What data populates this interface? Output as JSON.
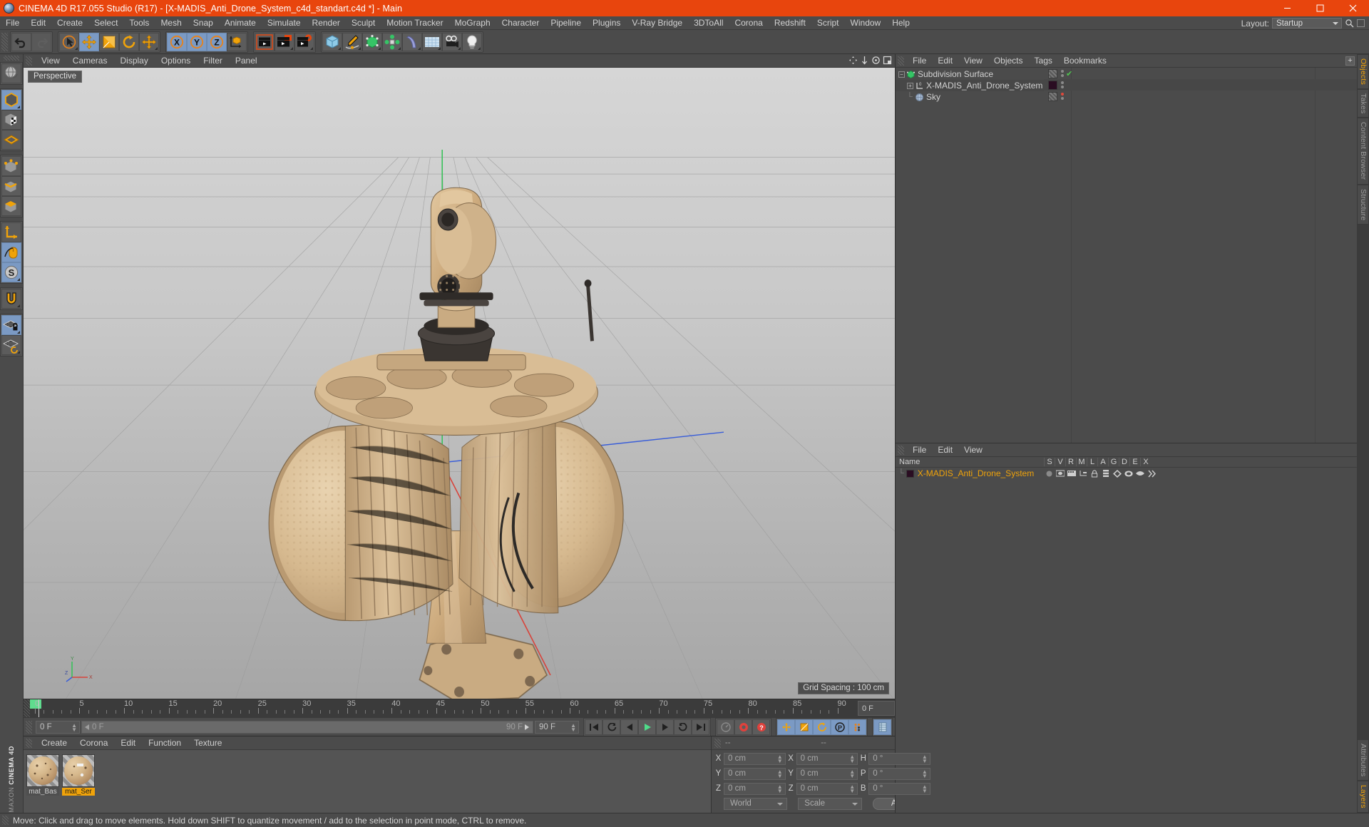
{
  "window": {
    "title": "CINEMA 4D R17.055 Studio (R17) - [X-MADIS_Anti_Drone_System_c4d_standart.c4d *] - Main",
    "app_icon": "c4d-logo-icon",
    "minimize": "minimize-icon",
    "maximize": "maximize-icon",
    "close": "close-icon",
    "titlebar_color": "#e8450d"
  },
  "menubar": {
    "items": [
      "File",
      "Edit",
      "Create",
      "Select",
      "Tools",
      "Mesh",
      "Snap",
      "Animate",
      "Simulate",
      "Render",
      "Sculpt",
      "Motion Tracker",
      "MoGraph",
      "Character",
      "Pipeline",
      "Plugins",
      "V-Ray Bridge",
      "3DToAll",
      "Corona",
      "Redshift",
      "Script",
      "Window",
      "Help"
    ],
    "layout_label": "Layout:",
    "layout_value": "Startup",
    "search_icon": "search-icon",
    "panel_icon": "panel-icon"
  },
  "toolbar": {
    "groups": [
      {
        "name": "history",
        "buttons": [
          {
            "name": "undo-button",
            "icon": "undo-icon",
            "active": false,
            "dim": false
          },
          {
            "name": "redo-button",
            "icon": "redo-icon",
            "active": false,
            "dim": true
          }
        ]
      },
      {
        "name": "selection-transform",
        "buttons": [
          {
            "name": "live-selection-button",
            "icon": "live-selection-icon",
            "active": false,
            "dim": false
          },
          {
            "name": "move-tool-button",
            "icon": "move-icon",
            "active": true,
            "dim": false
          },
          {
            "name": "scale-tool-button",
            "icon": "scale-icon",
            "active": false,
            "dim": false
          },
          {
            "name": "rotate-tool-button",
            "icon": "rotate-icon",
            "active": false,
            "dim": false
          },
          {
            "name": "move-alt-button",
            "icon": "move-icon",
            "active": false,
            "dim": false
          }
        ]
      },
      {
        "name": "axis-locks",
        "buttons": [
          {
            "name": "lock-x-button",
            "icon": "x-axis-icon",
            "active": true,
            "dim": false
          },
          {
            "name": "lock-y-button",
            "icon": "y-axis-icon",
            "active": true,
            "dim": false
          },
          {
            "name": "lock-z-button",
            "icon": "z-axis-icon",
            "active": true,
            "dim": false
          },
          {
            "name": "world-object-coordinates-button",
            "icon": "world-axis-icon",
            "active": false,
            "dim": false
          }
        ]
      },
      {
        "name": "render",
        "buttons": [
          {
            "name": "render-view-button",
            "icon": "render-view-icon",
            "active": false,
            "dim": false
          },
          {
            "name": "render-to-picture-viewer-button",
            "icon": "render-picture-viewer-icon",
            "active": false,
            "dim": false
          },
          {
            "name": "render-settings-button",
            "icon": "render-settings-icon",
            "active": false,
            "dim": false
          }
        ]
      },
      {
        "name": "primitives",
        "buttons": [
          {
            "name": "cube-primitive-button",
            "icon": "cube-icon",
            "active": false,
            "dim": false
          },
          {
            "name": "spline-pen-button",
            "icon": "pen-spline-icon",
            "active": false,
            "dim": false
          },
          {
            "name": "nurbs-button",
            "icon": "subdivision-surface-icon",
            "active": false,
            "dim": false
          },
          {
            "name": "array-button",
            "icon": "array-icon",
            "active": false,
            "dim": false
          },
          {
            "name": "bend-deformer-button",
            "icon": "bend-deformer-icon",
            "active": false,
            "dim": false
          },
          {
            "name": "floor-environment-button",
            "icon": "floor-icon",
            "active": false,
            "dim": false
          },
          {
            "name": "camera-button",
            "icon": "camera-icon",
            "active": false,
            "dim": false
          },
          {
            "name": "light-button",
            "icon": "light-bulb-icon",
            "active": false,
            "dim": false
          }
        ]
      }
    ]
  },
  "left_toolbar": {
    "groups": [
      [
        {
          "name": "undo-view-button",
          "icon": "globe-undo-icon",
          "active": false
        }
      ],
      [
        {
          "name": "make-editable-button",
          "icon": "make-editable-icon",
          "active": true
        },
        {
          "name": "model-mode-button",
          "icon": "model-mode-icon",
          "active": false
        },
        {
          "name": "texture-mode-button",
          "icon": "texture-axis-icon",
          "active": false
        }
      ],
      [
        {
          "name": "points-mode-button",
          "icon": "points-mode-icon",
          "active": false
        },
        {
          "name": "edges-mode-button",
          "icon": "edges-mode-icon",
          "active": false
        },
        {
          "name": "polygons-mode-button",
          "icon": "polygons-mode-icon",
          "active": false
        }
      ],
      [
        {
          "name": "enable-axis-modification-button",
          "icon": "axis-modification-icon",
          "active": false
        },
        {
          "name": "viewport-solo-button",
          "icon": "mouse-icon",
          "active": true
        },
        {
          "name": "soft-selection-button",
          "icon": "soft-selection-icon",
          "active": true
        }
      ],
      [
        {
          "name": "enable-snapping-button",
          "icon": "magnet-snap-icon",
          "active": false
        }
      ],
      [
        {
          "name": "lock-workplane-button",
          "icon": "workplane-lock-icon",
          "active": true
        },
        {
          "name": "workplane-rotate-button",
          "icon": "workplane-rotate-icon",
          "active": false
        }
      ]
    ],
    "brand_top": "MAXON",
    "brand_bottom": "CINEMA 4D"
  },
  "viewport": {
    "menu": [
      "View",
      "Cameras",
      "Display",
      "Options",
      "Filter",
      "Panel"
    ],
    "view_label": "Perspective",
    "grid_spacing": "Grid Spacing : 100 cm",
    "axis_labels": {
      "x": "X",
      "y": "Y",
      "z": "Z"
    },
    "corner_icons": [
      "pan-view-icon",
      "zoom-view-icon",
      "rotate-view-icon",
      "maximize-view-icon"
    ]
  },
  "timeline": {
    "ticks": [
      {
        "label": "0",
        "value": 0
      },
      {
        "label": "5",
        "value": 5
      },
      {
        "label": "10",
        "value": 10
      },
      {
        "label": "15",
        "value": 15
      },
      {
        "label": "20",
        "value": 20
      },
      {
        "label": "25",
        "value": 25
      },
      {
        "label": "30",
        "value": 30
      },
      {
        "label": "35",
        "value": 35
      },
      {
        "label": "40",
        "value": 40
      },
      {
        "label": "45",
        "value": 45
      },
      {
        "label": "50",
        "value": 50
      },
      {
        "label": "55",
        "value": 55
      },
      {
        "label": "60",
        "value": 60
      },
      {
        "label": "65",
        "value": 65
      },
      {
        "label": "70",
        "value": 70
      },
      {
        "label": "75",
        "value": 75
      },
      {
        "label": "80",
        "value": 80
      },
      {
        "label": "85",
        "value": 85
      },
      {
        "label": "90",
        "value": 90
      }
    ],
    "current_frame_box": "0 F",
    "range_start": "0 F",
    "range_end": "90 F",
    "max_frame": "90 F",
    "min_frame": "0 F"
  },
  "playback": {
    "buttons": [
      {
        "name": "go-to-start-button",
        "icon": "skip-start-icon",
        "active": false
      },
      {
        "name": "go-to-previous-key-button",
        "icon": "previous-key-icon",
        "active": false
      },
      {
        "name": "step-back-button",
        "icon": "step-back-icon",
        "active": false
      },
      {
        "name": "play-button",
        "icon": "play-icon",
        "active": false
      },
      {
        "name": "step-forward-button",
        "icon": "step-forward-icon",
        "active": false
      },
      {
        "name": "go-to-next-key-button",
        "icon": "next-key-icon",
        "active": false
      },
      {
        "name": "go-to-end-button",
        "icon": "skip-end-icon",
        "active": false
      }
    ],
    "record_buttons": [
      {
        "name": "autokeying-button",
        "icon": "autokey-icon",
        "active": false
      },
      {
        "name": "record-active-objects-button",
        "icon": "record-icon",
        "active": false
      },
      {
        "name": "keyframe-selection-button",
        "icon": "keyframe-help-icon",
        "active": false
      }
    ],
    "key_toggle_buttons": [
      {
        "name": "record-position-button",
        "icon": "position-key-icon",
        "active": true
      },
      {
        "name": "record-scale-button",
        "icon": "scale-key-icon",
        "active": true
      },
      {
        "name": "record-rotation-button",
        "icon": "rotation-key-icon",
        "active": true
      },
      {
        "name": "record-pla-button",
        "icon": "pla-key-icon",
        "active": true
      },
      {
        "name": "record-parameter-button",
        "icon": "parameter-key-icon",
        "active": true
      }
    ],
    "extra_button": {
      "name": "timeline-settings-button",
      "icon": "timeline-settings-icon",
      "active": true
    }
  },
  "material_manager": {
    "menu": [
      "Create",
      "Corona",
      "Edit",
      "Function",
      "Texture"
    ],
    "materials": [
      {
        "name": "mat_Bas",
        "selected": false
      },
      {
        "name": "mat_Ser",
        "selected": true
      }
    ]
  },
  "coordinate_manager": {
    "headers": [
      "--",
      "--",
      "--"
    ],
    "rows": [
      {
        "pos_label": "X",
        "pos_value": "0 cm",
        "size_label": "X",
        "size_value": "0 cm",
        "rot_label": "H",
        "rot_value": "0 °"
      },
      {
        "pos_label": "Y",
        "pos_value": "0 cm",
        "size_label": "Y",
        "size_value": "0 cm",
        "rot_label": "P",
        "rot_value": "0 °"
      },
      {
        "pos_label": "Z",
        "pos_value": "0 cm",
        "size_label": "Z",
        "size_value": "0 cm",
        "rot_label": "B",
        "rot_value": "0 °"
      }
    ],
    "system": "World",
    "mode": "Scale",
    "apply_label": "Apply"
  },
  "object_manager": {
    "menu": [
      "File",
      "Edit",
      "View",
      "Objects",
      "Tags",
      "Bookmarks"
    ],
    "add_button": "+",
    "items": [
      {
        "name": "Subdivision Surface",
        "icon": "subdivision-surface-icon",
        "indent": 0,
        "expander": "-",
        "tag_color": "#6b6b6b",
        "tag_type": "hatched",
        "marker": "check",
        "selected": false
      },
      {
        "name": "X-MADIS_Anti_Drone_System",
        "icon": "null-object-icon",
        "indent": 1,
        "expander": "+",
        "tag_color": "#2a0d22",
        "tag_type": "solid",
        "marker": "dots",
        "selected": false
      },
      {
        "name": "Sky",
        "icon": "sky-object-icon",
        "indent": 1,
        "expander": "",
        "tag_color": "#6b6b6b",
        "tag_type": "hatched",
        "marker": "reddot",
        "selected": false
      }
    ]
  },
  "attribute_manager": {
    "menu": [
      "File",
      "Edit",
      "View"
    ],
    "columns": [
      "Name",
      "S",
      "V",
      "R",
      "M",
      "L",
      "A",
      "G",
      "D",
      "E",
      "X"
    ],
    "rows": [
      {
        "name": "X-MADIS_Anti_Drone_System",
        "color": "#2a0d22",
        "selected": true,
        "icons": [
          "sphere-dot-icon",
          "visibility-icon",
          "render-icon",
          "hierarchy-icon",
          "lock-icon",
          "layer-icon",
          "generator-icon",
          "deformer-icon",
          "expression-icon",
          "xref-icon"
        ]
      }
    ]
  },
  "side_tabs": {
    "top": [
      {
        "label": "Objects",
        "active": true
      },
      {
        "label": "Takes",
        "active": false
      },
      {
        "label": "Content Browser",
        "active": false
      },
      {
        "label": "Structure",
        "active": false
      }
    ],
    "bottom": [
      {
        "label": "Attributes",
        "active": false
      },
      {
        "label": "Layers",
        "active": true
      }
    ]
  },
  "statusbar": {
    "message": "Move: Click and drag to move elements. Hold down SHIFT to quantize movement / add to the selection in point mode, CTRL to remove."
  },
  "colors": {
    "accent_orange": "#e8450d",
    "highlight_yellow": "#f0a30a",
    "panel_bg": "#4b4b4b",
    "active_blue": "#7b9ac4"
  }
}
